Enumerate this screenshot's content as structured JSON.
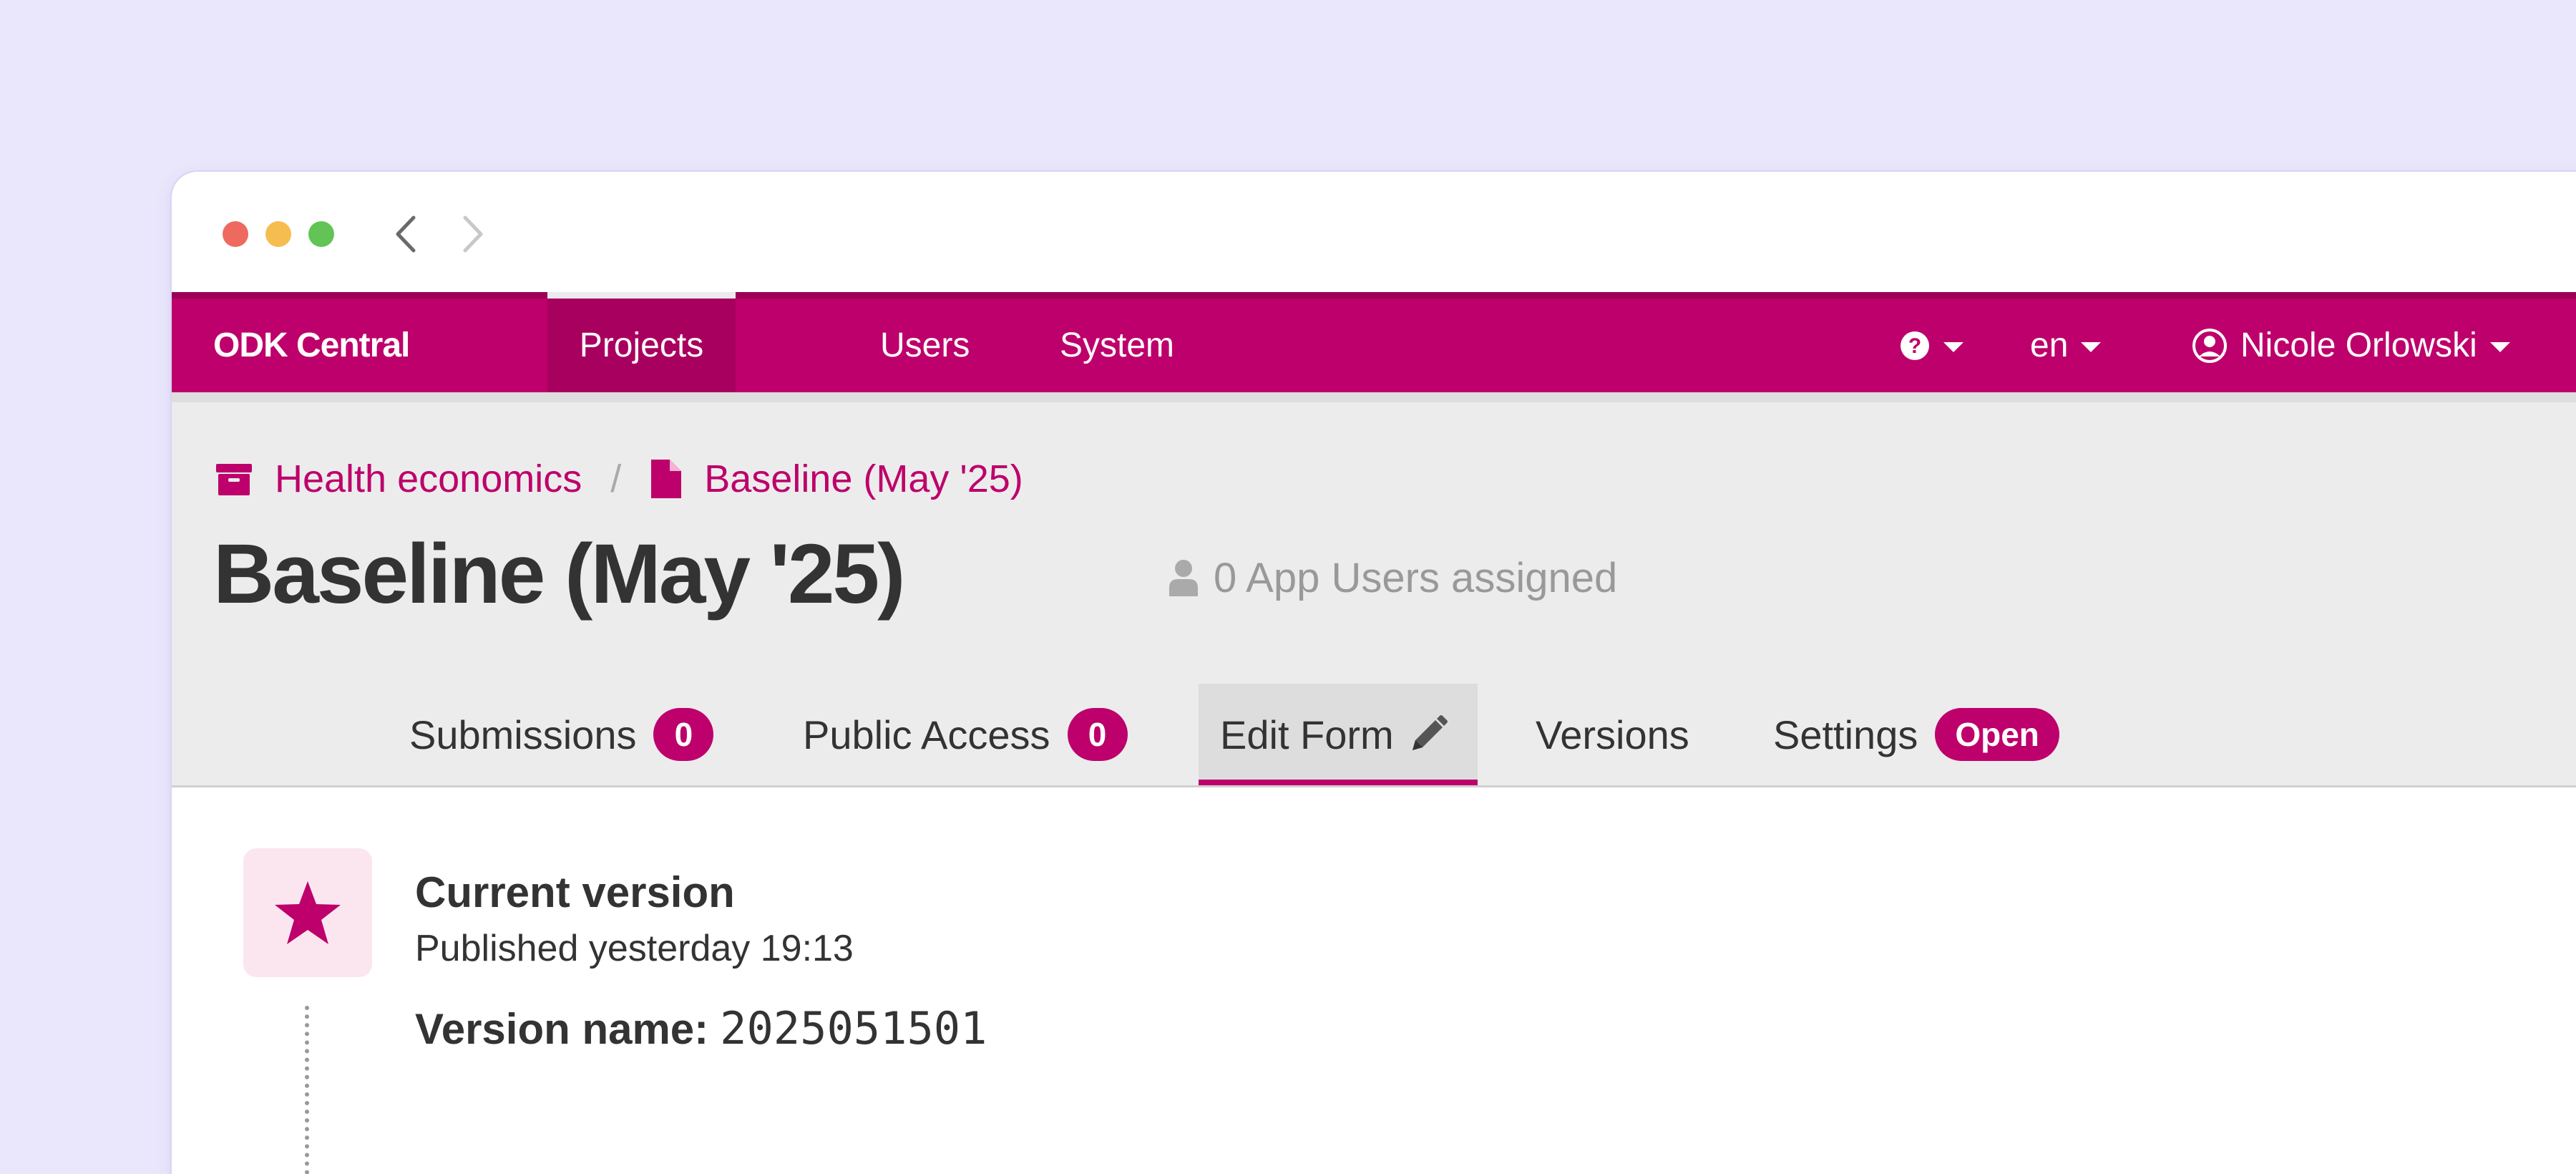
{
  "browser": {
    "traffic_lights": [
      "close",
      "minimize",
      "zoom"
    ],
    "nav": [
      "back-icon",
      "forward-icon"
    ]
  },
  "navbar": {
    "brand": "ODK Central",
    "items": [
      {
        "label": "Projects",
        "active": true
      },
      {
        "label": "Users",
        "active": false
      },
      {
        "label": "System",
        "active": false
      }
    ],
    "help_icon": "question-circle-icon",
    "language": "en",
    "user_name": "Nicole Orlowski",
    "user_icon": "user-circle-icon",
    "brand_color": "#bd006b"
  },
  "breadcrumb": {
    "project": "Health economics",
    "project_icon": "archive-icon",
    "separator": "/",
    "form": "Baseline (May '25)",
    "form_icon": "file-icon"
  },
  "page": {
    "title": "Baseline (May '25)",
    "app_users": "0 App Users assigned",
    "app_users_icon": "user-icon"
  },
  "tabs": [
    {
      "label": "Submissions",
      "badge": "0",
      "active": false
    },
    {
      "label": "Public Access",
      "badge": "0",
      "active": false
    },
    {
      "label": "Edit Form",
      "icon": "pencil-icon",
      "active": true
    },
    {
      "label": "Versions",
      "active": false
    },
    {
      "label": "Settings",
      "badge": "Open",
      "active": false
    }
  ],
  "current_version": {
    "icon": "star-icon",
    "title": "Current version",
    "published": "Published yesterday 19:13",
    "version_label": "Version name:",
    "version_value": "2025051501"
  }
}
